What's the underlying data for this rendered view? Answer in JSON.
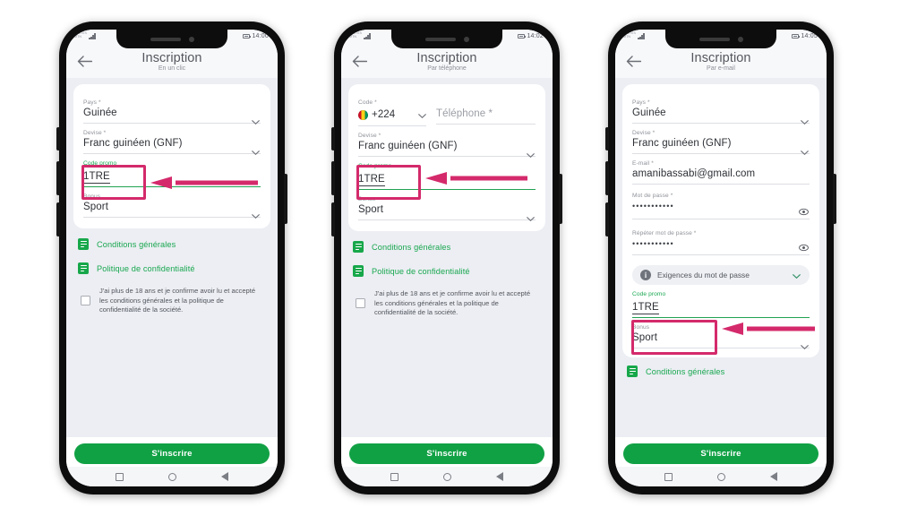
{
  "meta": {
    "accent_green": "#11a145",
    "link_green": "#19a750",
    "highlight_pink": "#d42a6b",
    "screen_bg": "#eceef3"
  },
  "phones": [
    {
      "id": "phone-one-click",
      "status": {
        "carrier_line1": "CELTIIS",
        "carrier_line2": "MTN",
        "time": "14:00"
      },
      "header": {
        "title": "Inscription",
        "subtitle": "En un clic"
      },
      "fields": [
        {
          "type": "select",
          "label": "Pays *",
          "value": "Guinée"
        },
        {
          "type": "select",
          "label": "Devise *",
          "value": "Franc guinéen (GNF)"
        },
        {
          "type": "text",
          "label": "Code promo",
          "value": "1TRE",
          "highlight": true
        },
        {
          "type": "select",
          "label": "Bonus",
          "value": "Sport"
        }
      ],
      "links": [
        {
          "label": "Conditions générales"
        },
        {
          "label": "Politique de confidentialité"
        }
      ],
      "agreement": "J'ai plus de 18 ans et je confirme avoir lu et accepté les conditions générales et la politique de confidentialité de la société.",
      "cta": "S'inscrire"
    },
    {
      "id": "phone-by-phone",
      "status": {
        "carrier_line1": "CELTIIS",
        "carrier_line2": "MTN",
        "time": "14:02"
      },
      "header": {
        "title": "Inscription",
        "subtitle": "Par téléphone"
      },
      "phone_row": {
        "code_label": "Code *",
        "code_value": "+224",
        "number_placeholder": "Téléphone *"
      },
      "fields": [
        {
          "type": "select",
          "label": "Devise *",
          "value": "Franc guinéen (GNF)"
        },
        {
          "type": "text",
          "label": "Code promo",
          "value": "1TRE",
          "highlight": true
        },
        {
          "type": "select",
          "label": "Bonus",
          "value": "Sport"
        }
      ],
      "links": [
        {
          "label": "Conditions générales"
        },
        {
          "label": "Politique de confidentialité"
        }
      ],
      "agreement": "J'ai plus de 18 ans et je confirme avoir lu et accepté les conditions générales et la politique de confidentialité de la société.",
      "cta": "S'inscrire"
    },
    {
      "id": "phone-by-email",
      "status": {
        "carrier_line1": "CELTIIS",
        "carrier_line2": "MTN",
        "time": "14:05"
      },
      "header": {
        "title": "Inscription",
        "subtitle": "Par e-mail"
      },
      "fields": [
        {
          "type": "select",
          "label": "Pays *",
          "value": "Guinée"
        },
        {
          "type": "select",
          "label": "Devise *",
          "value": "Franc guinéen (GNF)"
        },
        {
          "type": "text",
          "label": "E-mail *",
          "value": "amanibassabi@gmail.com"
        },
        {
          "type": "password",
          "label": "Mot de passe *",
          "value": "•••••••••••"
        },
        {
          "type": "password",
          "label": "Répéter mot de passe *",
          "value": "•••••••••••"
        }
      ],
      "requirements_bar": {
        "label": "Exigences du mot de passe"
      },
      "promo": {
        "label": "Code promo",
        "value": "1TRE"
      },
      "bonus": {
        "label": "Bonus",
        "value": "Sport"
      },
      "links": [
        {
          "label": "Conditions générales"
        }
      ],
      "cta": "S'inscrire"
    }
  ]
}
